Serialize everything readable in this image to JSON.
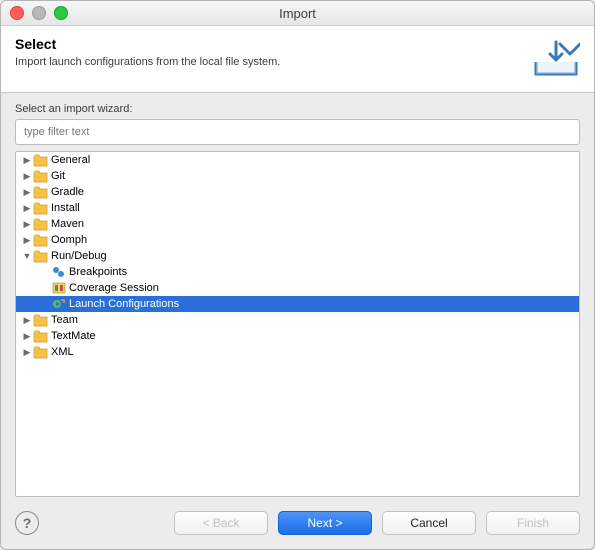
{
  "window": {
    "title": "Import"
  },
  "header": {
    "title": "Select",
    "subtitle": "Import launch configurations from the local file system."
  },
  "filter": {
    "label": "Select an import wizard:",
    "placeholder": "type filter text",
    "value": ""
  },
  "tree": [
    {
      "label": "General",
      "depth": 0,
      "expanded": false,
      "icon": "folder",
      "selected": false,
      "hasChildren": true
    },
    {
      "label": "Git",
      "depth": 0,
      "expanded": false,
      "icon": "folder",
      "selected": false,
      "hasChildren": true
    },
    {
      "label": "Gradle",
      "depth": 0,
      "expanded": false,
      "icon": "folder",
      "selected": false,
      "hasChildren": true
    },
    {
      "label": "Install",
      "depth": 0,
      "expanded": false,
      "icon": "folder",
      "selected": false,
      "hasChildren": true
    },
    {
      "label": "Maven",
      "depth": 0,
      "expanded": false,
      "icon": "folder",
      "selected": false,
      "hasChildren": true
    },
    {
      "label": "Oomph",
      "depth": 0,
      "expanded": false,
      "icon": "folder",
      "selected": false,
      "hasChildren": true
    },
    {
      "label": "Run/Debug",
      "depth": 0,
      "expanded": true,
      "icon": "folder-open",
      "selected": false,
      "hasChildren": true
    },
    {
      "label": "Breakpoints",
      "depth": 1,
      "expanded": false,
      "icon": "breakpoints",
      "selected": false,
      "hasChildren": false
    },
    {
      "label": "Coverage Session",
      "depth": 1,
      "expanded": false,
      "icon": "coverage",
      "selected": false,
      "hasChildren": false
    },
    {
      "label": "Launch Configurations",
      "depth": 1,
      "expanded": false,
      "icon": "launch",
      "selected": true,
      "hasChildren": false
    },
    {
      "label": "Team",
      "depth": 0,
      "expanded": false,
      "icon": "folder",
      "selected": false,
      "hasChildren": true
    },
    {
      "label": "TextMate",
      "depth": 0,
      "expanded": false,
      "icon": "folder",
      "selected": false,
      "hasChildren": true
    },
    {
      "label": "XML",
      "depth": 0,
      "expanded": false,
      "icon": "folder",
      "selected": false,
      "hasChildren": true
    }
  ],
  "buttons": {
    "back": "< Back",
    "next": "Next >",
    "cancel": "Cancel",
    "finish": "Finish"
  }
}
